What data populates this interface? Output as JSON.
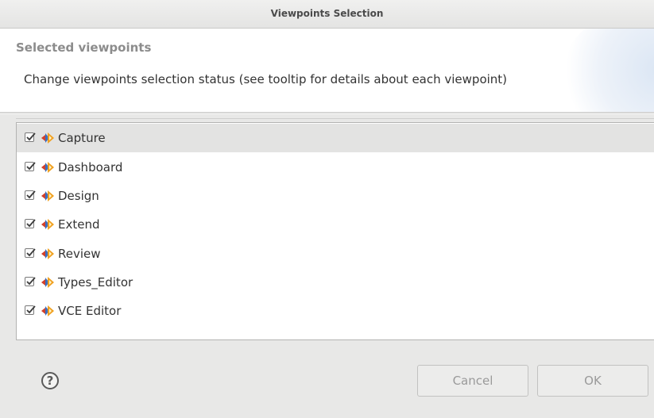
{
  "window": {
    "title": "Viewpoints Selection"
  },
  "header": {
    "heading": "Selected viewpoints",
    "message": "Change viewpoints selection status (see tooltip for details about each viewpoint)"
  },
  "viewpoints": [
    {
      "label": "Capture",
      "checked": true,
      "selected": true
    },
    {
      "label": "Dashboard",
      "checked": true,
      "selected": false
    },
    {
      "label": "Design",
      "checked": true,
      "selected": false
    },
    {
      "label": "Extend",
      "checked": true,
      "selected": false
    },
    {
      "label": "Review",
      "checked": true,
      "selected": false
    },
    {
      "label": "Types_Editor",
      "checked": true,
      "selected": false
    },
    {
      "label": "VCE Editor",
      "checked": true,
      "selected": false
    }
  ],
  "icons": {
    "viewpoint": "viewpoint-icon",
    "help": "help-icon",
    "checkbox": "checkbox-checked-icon"
  },
  "colors": {
    "viewpoint_icon_orange": "#f0a020",
    "viewpoint_icon_red": "#d2402a",
    "viewpoint_icon_blue": "#3a6fc0",
    "selected_row": "#e3e3e2"
  },
  "footer": {
    "help_glyph": "?",
    "cancel_label": "Cancel",
    "ok_label": "OK"
  }
}
